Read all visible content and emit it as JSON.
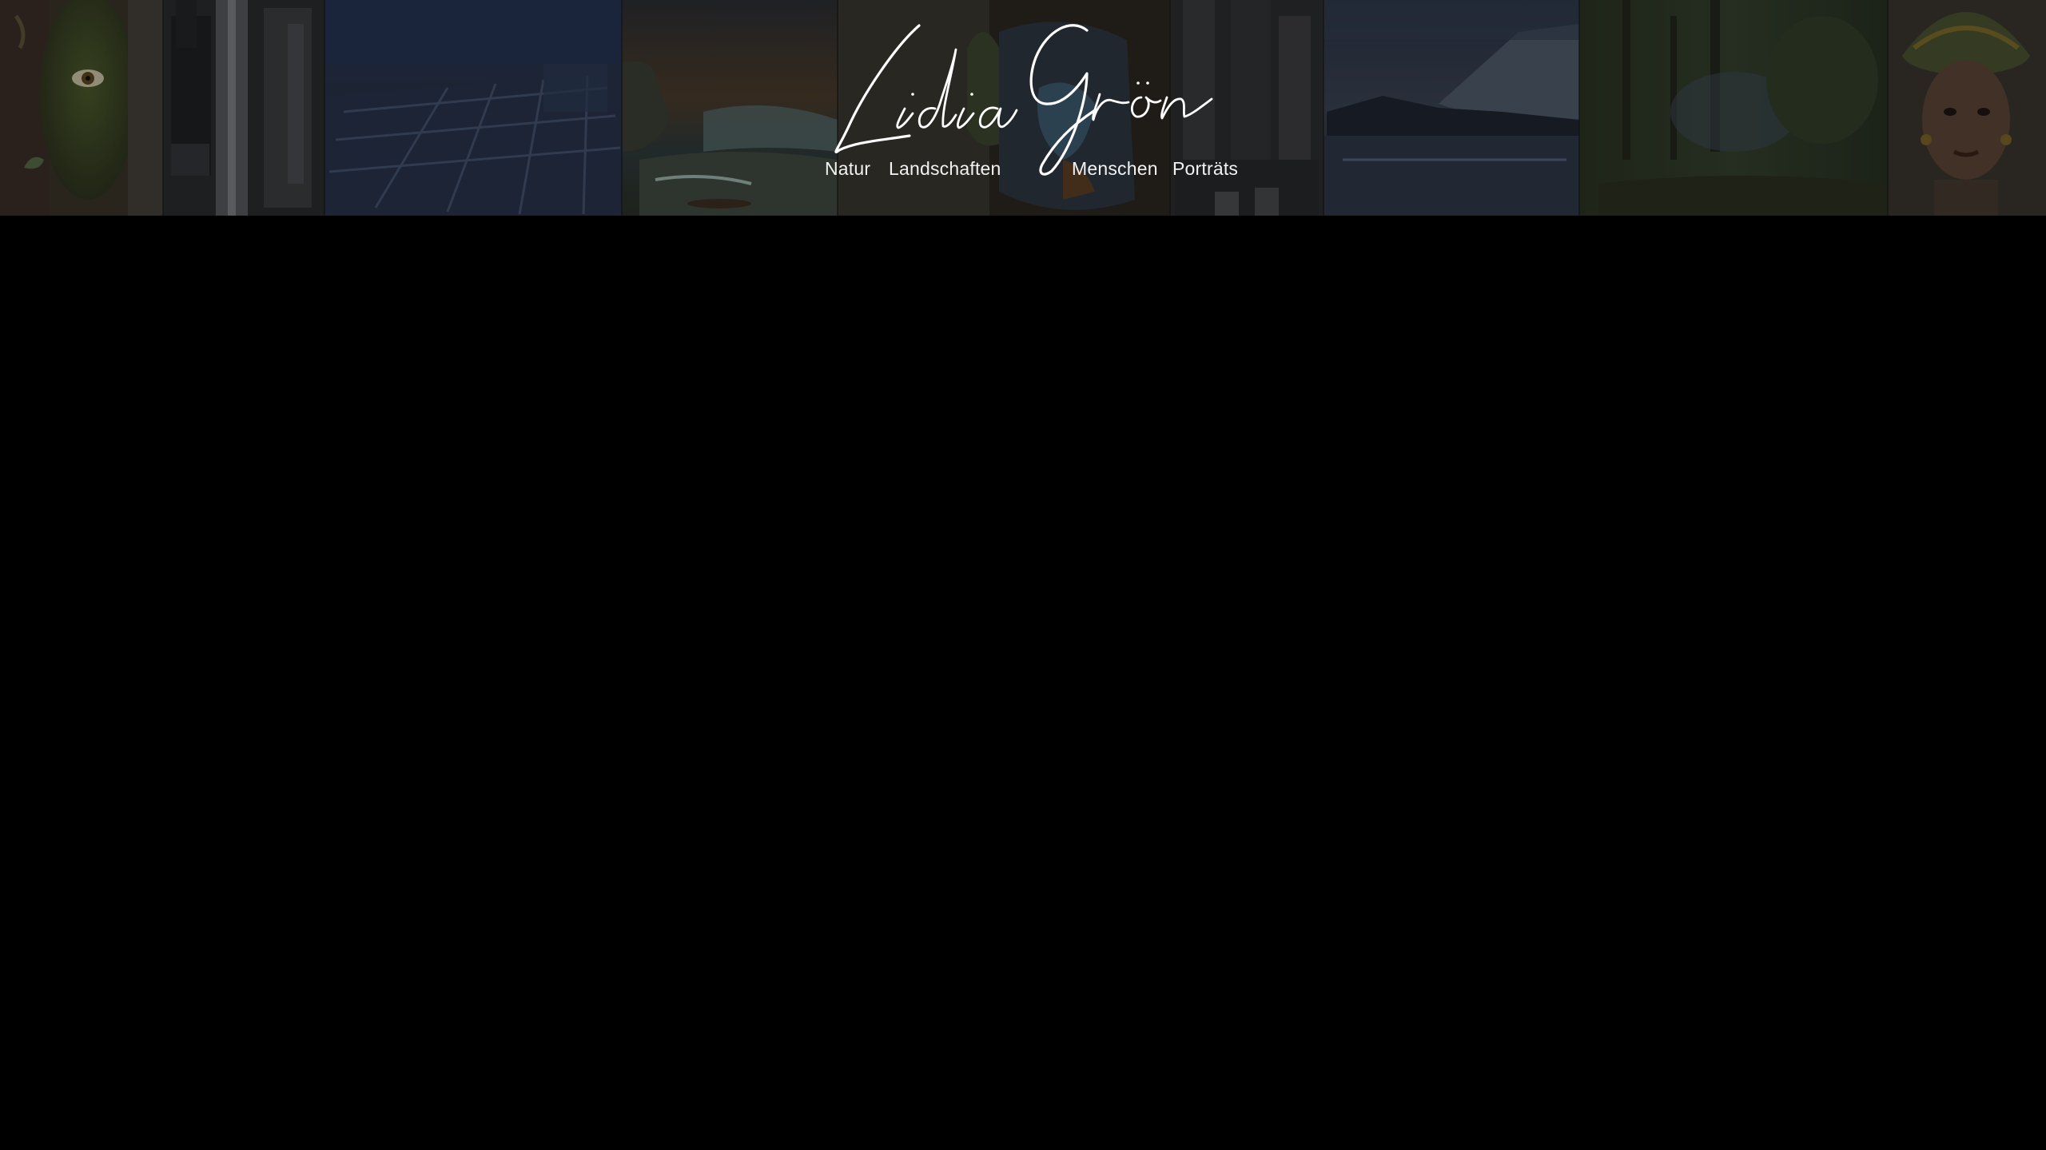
{
  "site": {
    "logo_text": "Lidia Grön"
  },
  "nav": {
    "items": [
      {
        "label": "Natur"
      },
      {
        "label": "Landschaften"
      },
      {
        "label": "Menschen"
      },
      {
        "label": "Porträts"
      }
    ]
  },
  "header": {
    "panels": [
      {
        "name": "lizard-face-painting",
        "color": "#3b3d33"
      },
      {
        "name": "waterfall-city-painting",
        "color": "#2c2d30"
      },
      {
        "name": "blue-city-painting",
        "color": "#28344a"
      },
      {
        "name": "seaside-sunset-painting",
        "color": "#30342f"
      },
      {
        "name": "colorful-portrait-painting",
        "color": "#2e2c28"
      },
      {
        "name": "stone-columns-painting",
        "color": "#2c2d2f"
      },
      {
        "name": "mountain-lake-painting",
        "color": "#262c36"
      },
      {
        "name": "forest-stream-painting",
        "color": "#2a3126"
      },
      {
        "name": "turban-woman-portrait-painting",
        "color": "#2e2924"
      }
    ]
  }
}
